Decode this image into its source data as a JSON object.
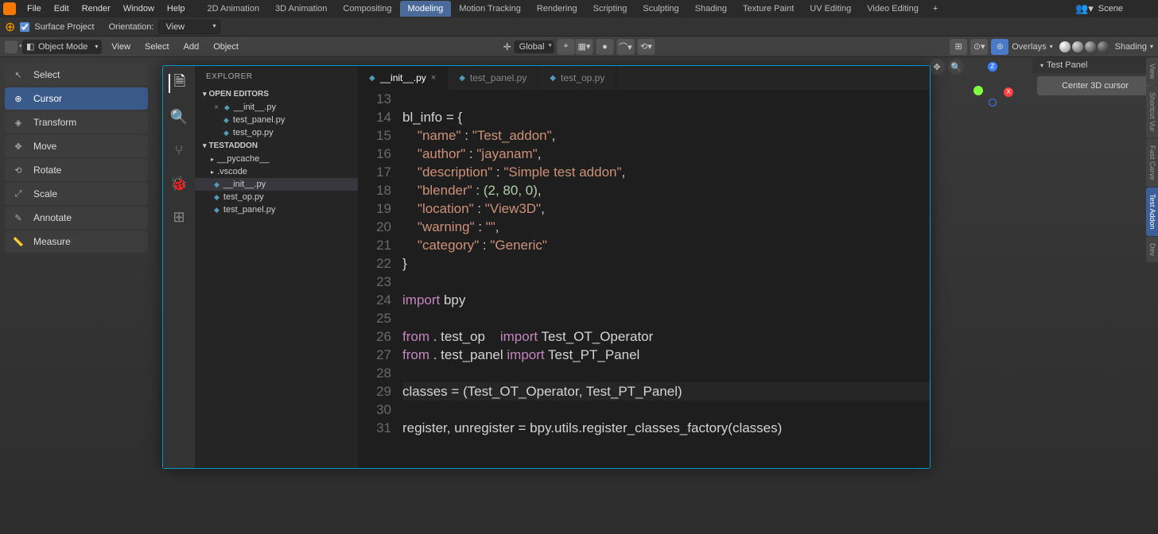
{
  "menubar": {
    "items": [
      "File",
      "Edit",
      "Render",
      "Window",
      "Help"
    ],
    "scene_label": "Scene"
  },
  "workspace_tabs": [
    "2D Animation",
    "3D Animation",
    "Compositing",
    "Modeling",
    "Motion Tracking",
    "Rendering",
    "Scripting",
    "Sculpting",
    "Shading",
    "Texture Paint",
    "UV Editing",
    "Video Editing"
  ],
  "workspace_active_index": 3,
  "toolbar2": {
    "surface_project": "Surface Project",
    "orientation_label": "Orientation:",
    "orientation_value": "View"
  },
  "header3": {
    "mode": "Object Mode",
    "items": [
      "View",
      "Select",
      "Add",
      "Object"
    ],
    "transform_orientation": "Global",
    "overlays_label": "Overlays",
    "shading_label": "Shading"
  },
  "tools": [
    {
      "icon": "↖",
      "label": "Select"
    },
    {
      "icon": "⊕",
      "label": "Cursor"
    },
    {
      "icon": "◈",
      "label": "Transform"
    },
    {
      "icon": "✥",
      "label": "Move"
    },
    {
      "icon": "⟲",
      "label": "Rotate"
    },
    {
      "icon": "⤢",
      "label": "Scale"
    },
    {
      "icon": "✎",
      "label": "Annotate"
    },
    {
      "icon": "📏",
      "label": "Measure"
    }
  ],
  "tools_active_index": 1,
  "right_panel": {
    "title": "Test Panel",
    "button": "Center 3D cursor"
  },
  "side_tabs_right": [
    "View",
    "Shortcut Vur",
    "Fast Carve",
    "Test Addon",
    "Dev"
  ],
  "side_tabs_right_active": 3,
  "navball": {
    "z": "Z",
    "x": "X"
  },
  "editor": {
    "explorer_title": "EXPLORER",
    "open_editors_label": "OPEN EDITORS",
    "project_label": "TESTADDON",
    "open_editors": [
      "__init__.py",
      "test_panel.py",
      "test_op.py"
    ],
    "folders": [
      "__pycache__",
      ".vscode"
    ],
    "files": [
      "__init__.py",
      "test_op.py",
      "test_panel.py"
    ],
    "selected_file": "__init__.py",
    "tabs": [
      "__init__.py",
      "test_panel.py",
      "test_op.py"
    ],
    "active_tab_index": 0,
    "line_start": 13,
    "line_end": 31,
    "code": {
      "l14": "bl_info = {",
      "l15_key": "\"name\"",
      "l15_val": "\"Test_addon\"",
      "l16_key": "\"author\"",
      "l16_val": "\"jayanam\"",
      "l17_key": "\"description\"",
      "l17_val": "\"Simple test addon\"",
      "l18_key": "\"blender\"",
      "l18_val": "(2, 80, 0)",
      "l19_key": "\"location\"",
      "l19_val": "\"View3D\"",
      "l20_key": "\"warning\"",
      "l20_val": "\"\"",
      "l21_key": "\"category\"",
      "l21_val": "\"Generic\"",
      "l22": "}",
      "l24": "import",
      "l24_mod": "bpy",
      "l26_from": "from",
      "l26_mod": ". test_op",
      "l26_import": "import",
      "l26_name": "Test_OT_Operator",
      "l27_from": "from",
      "l27_mod": ". test_panel",
      "l27_import": "import",
      "l27_name": "Test_PT_Panel",
      "l29_a": "classes = ",
      "l29_b": "(Test_OT_Operator, Test_PT_Panel)",
      "l31": "register, unregister = bpy.utils.register_classes_factory(classes)"
    }
  }
}
